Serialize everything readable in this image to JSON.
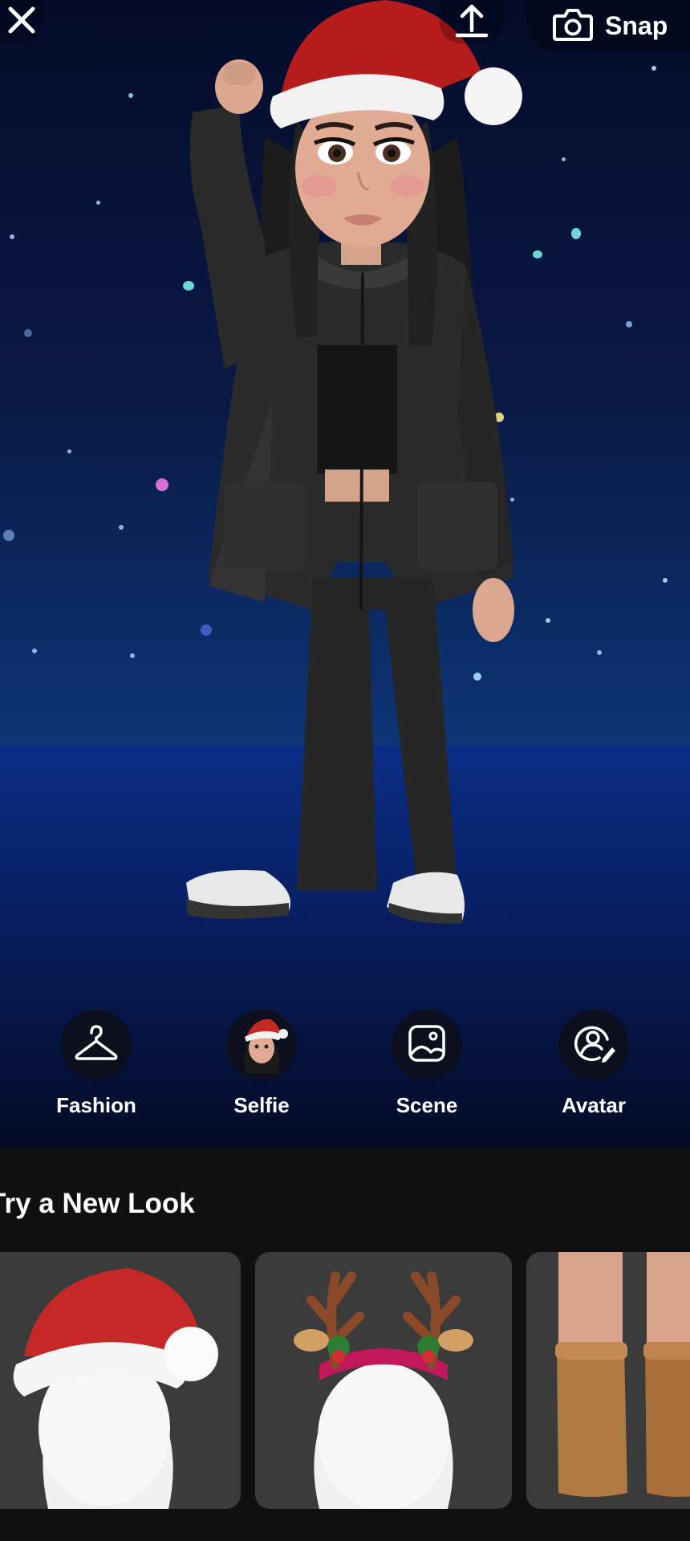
{
  "topbar": {
    "close_icon": "close-icon",
    "upload_icon": "upload-icon",
    "snap_icon": "camera-icon",
    "snap_label": "Snap"
  },
  "actions": [
    {
      "label": "Fashion",
      "icon": "hanger-icon"
    },
    {
      "label": "Selfie",
      "icon": "selfie-avatar-icon"
    },
    {
      "label": "Scene",
      "icon": "image-icon"
    },
    {
      "label": "Avatar",
      "icon": "avatar-edit-icon"
    }
  ],
  "sheet": {
    "title": "Try a New Look",
    "looks": [
      {
        "name": "santa-hat"
      },
      {
        "name": "reindeer-antlers"
      },
      {
        "name": "brown-boots"
      }
    ]
  },
  "colors": {
    "background_top": "#050c2a",
    "horizon": "#2aa7e4",
    "sheet": "#111111",
    "card": "#3b3b3b"
  }
}
